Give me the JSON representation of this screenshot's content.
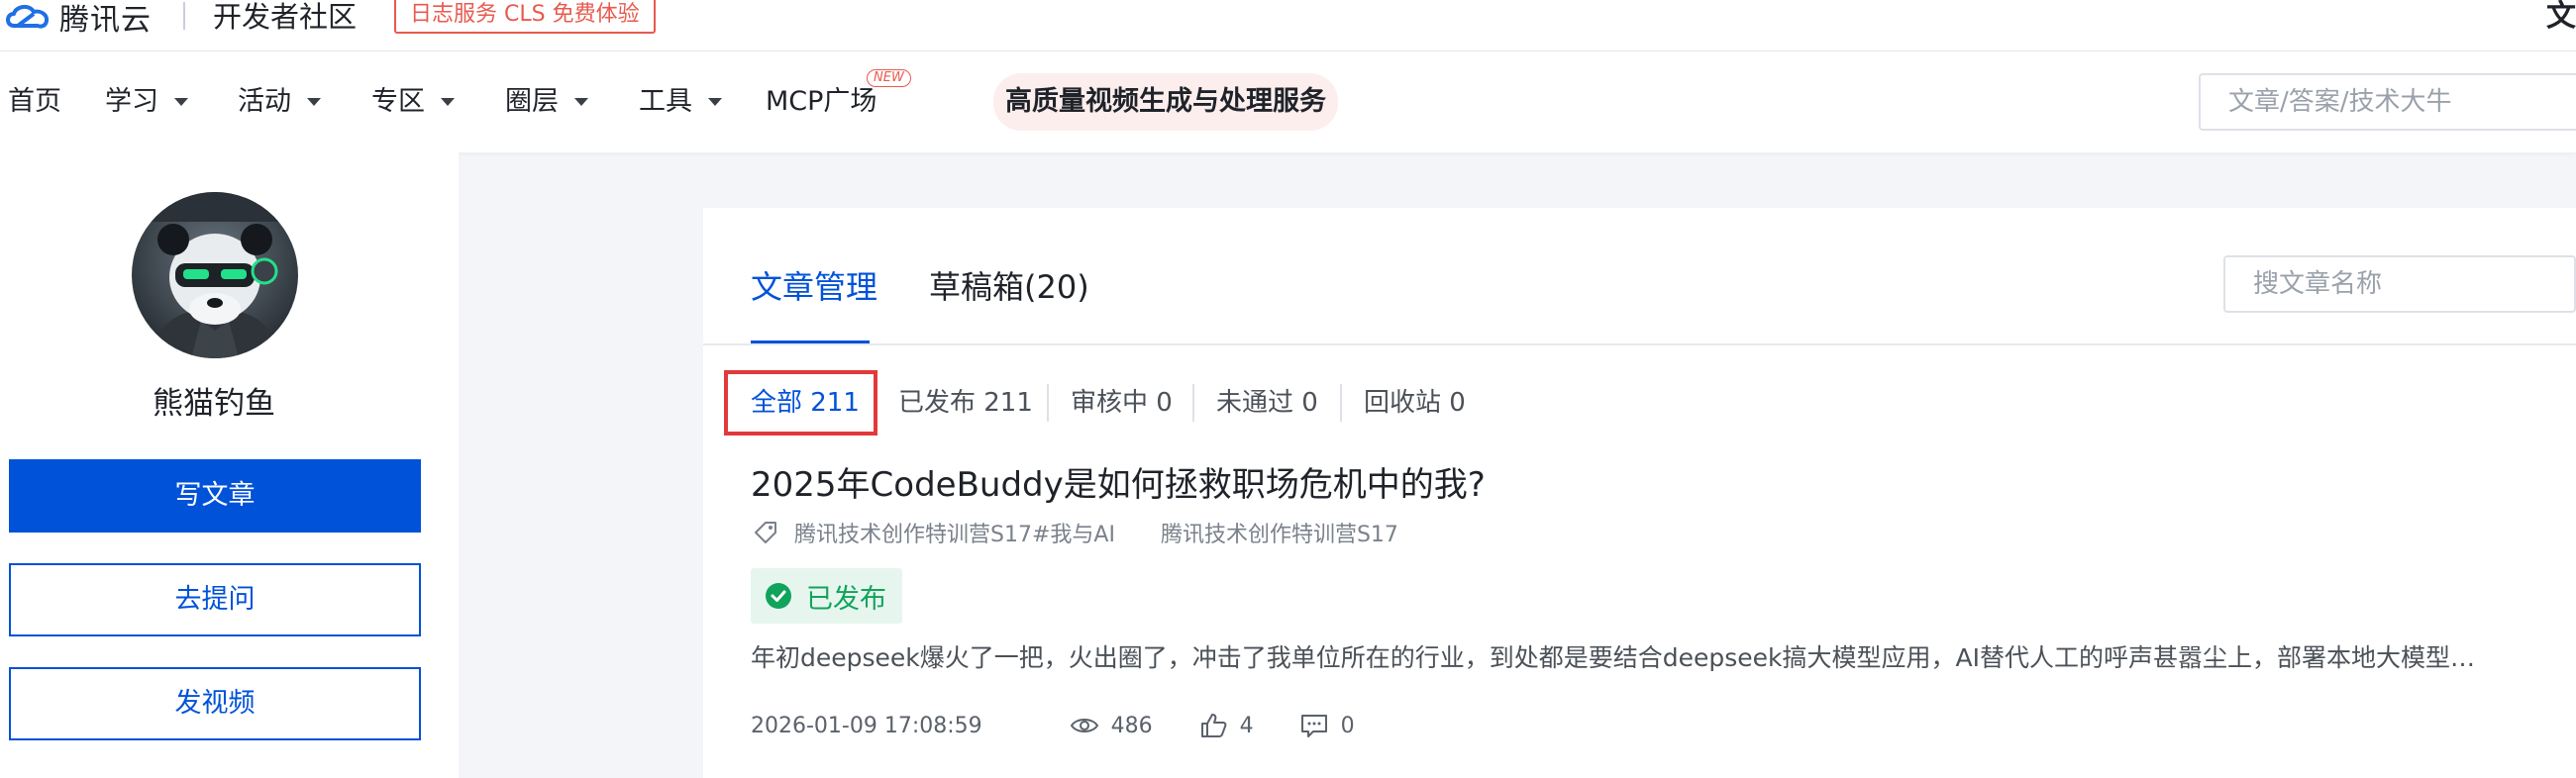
{
  "topbar": {
    "logo_text": "腾讯云",
    "community": "开发者社区",
    "promo": "日志服务 CLS 免费体验",
    "right_glyph": "文"
  },
  "nav": {
    "items": [
      {
        "label": "首页",
        "dropdown": false
      },
      {
        "label": "学习",
        "dropdown": true
      },
      {
        "label": "活动",
        "dropdown": true
      },
      {
        "label": "专区",
        "dropdown": true
      },
      {
        "label": "圈层",
        "dropdown": true
      },
      {
        "label": "工具",
        "dropdown": true
      },
      {
        "label": "MCP广场",
        "dropdown": false
      }
    ],
    "new_badge": "NEW",
    "highlight": "高质量视频生成与处理服务",
    "search_placeholder": "文章/答案/技术大牛"
  },
  "sidebar": {
    "username": "熊猫钓鱼",
    "write_article": "写文章",
    "ask_question": "去提问",
    "post_video": "发视频"
  },
  "main": {
    "tabs": [
      {
        "label": "文章管理",
        "active": true
      },
      {
        "label": "草稿箱(20)",
        "active": false
      }
    ],
    "search_placeholder": "搜文章名称",
    "filters": [
      {
        "label": "全部 211",
        "active": true
      },
      {
        "label": "已发布 211",
        "active": false
      },
      {
        "label": "审核中 0",
        "active": false
      },
      {
        "label": "未通过 0",
        "active": false
      },
      {
        "label": "回收站 0",
        "active": false
      }
    ],
    "article": {
      "title": "2025年CodeBuddy是如何拯救职场危机中的我?",
      "tags": [
        "腾讯技术创作特训营S17#我与AI",
        "腾讯技术创作特训营S17"
      ],
      "status": "已发布",
      "summary": "年初deepseek爆火了一把，火出圈了，冲击了我单位所在的行业，到处都是要结合deepseek搞大模型应用，AI替代人工的呼声甚嚣尘上，部署本地大模型…",
      "date": "2026-01-09 17:08:59",
      "views": "486",
      "likes": "4",
      "comments": "0"
    }
  },
  "colors": {
    "brand_blue": "#0052d9",
    "promo_red": "#e85a4f",
    "highlight_red": "#e2393b",
    "success_green": "#11a35c"
  }
}
